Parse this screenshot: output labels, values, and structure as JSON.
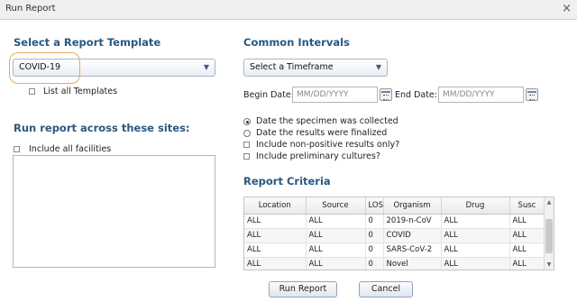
{
  "window": {
    "title": "Run Report",
    "close_glyph": "×"
  },
  "template": {
    "heading": "Select a Report Template",
    "selected": "COVID-19",
    "list_all_label": "List all Templates"
  },
  "sites": {
    "heading": "Run report across these sites:",
    "include_all_label": "Include all facilities"
  },
  "intervals": {
    "heading": "Common Intervals",
    "timeframe_selected": "Select a Timeframe",
    "begin_label": "Begin Date:",
    "begin_placeholder": "MM/DD/YYYY",
    "end_label": "End Date:",
    "end_placeholder": "MM/DD/YYYY"
  },
  "options": {
    "radio_collected": "Date the specimen was collected",
    "radio_finalized": "Date the results were finalized",
    "check_nonpositive": "Include non-positive results only?",
    "check_preliminary": "Include preliminary cultures?"
  },
  "criteria": {
    "heading": "Report Criteria",
    "columns": [
      "Location",
      "Source",
      "LOS",
      "Organism",
      "Drug",
      "Susc"
    ],
    "rows": [
      [
        "ALL",
        "ALL",
        "0",
        "2019-n-CoV",
        "ALL",
        "ALL"
      ],
      [
        "ALL",
        "ALL",
        "0",
        "COVID",
        "ALL",
        "ALL"
      ],
      [
        "ALL",
        "ALL",
        "0",
        "SARS-CoV-2",
        "ALL",
        "ALL"
      ],
      [
        "ALL",
        "ALL",
        "0",
        "Novel",
        "ALL",
        "ALL"
      ]
    ]
  },
  "buttons": {
    "run": "Run Report",
    "cancel": "Cancel"
  },
  "icons": {
    "dropdown": "chevron-down-icon",
    "calendar": "calendar-icon",
    "close": "close-icon"
  },
  "colors": {
    "heading": "#2a5880",
    "highlight": "#e8a85c",
    "button_border": "#8fa4bd"
  }
}
